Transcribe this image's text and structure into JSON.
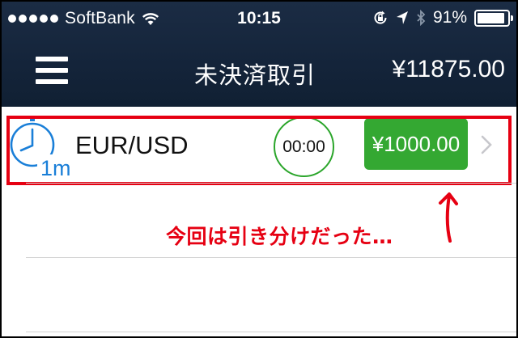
{
  "status_bar": {
    "carrier": "SoftBank",
    "time": "10:15",
    "battery_percent": "91%",
    "battery_level": 0.91,
    "signal_dots": 5,
    "icons": [
      "wifi-icon",
      "orientation-lock-icon",
      "location-arrow-icon",
      "bluetooth-icon",
      "battery-icon"
    ]
  },
  "navbar": {
    "title": "未決済取引",
    "balance": "¥11875.00",
    "menu_icon": "hamburger-menu-icon"
  },
  "trade_row": {
    "icon": "clock-1m-icon",
    "icon_label": "1m",
    "pair": "EUR/USD",
    "timer": "00:00",
    "payout": "¥1000.00",
    "chevron_icon": "chevron-right-icon"
  },
  "annotation": {
    "text": "今回は引き分けだった…",
    "arrow_icon": "hand-drawn-up-arrow",
    "color": "#e60012"
  },
  "colors": {
    "header_bg": "#14243a",
    "payout_green": "#34a832",
    "timer_ring": "#2aa52a",
    "highlight_red": "#e60012",
    "clock_blue": "#1a7fd8"
  }
}
